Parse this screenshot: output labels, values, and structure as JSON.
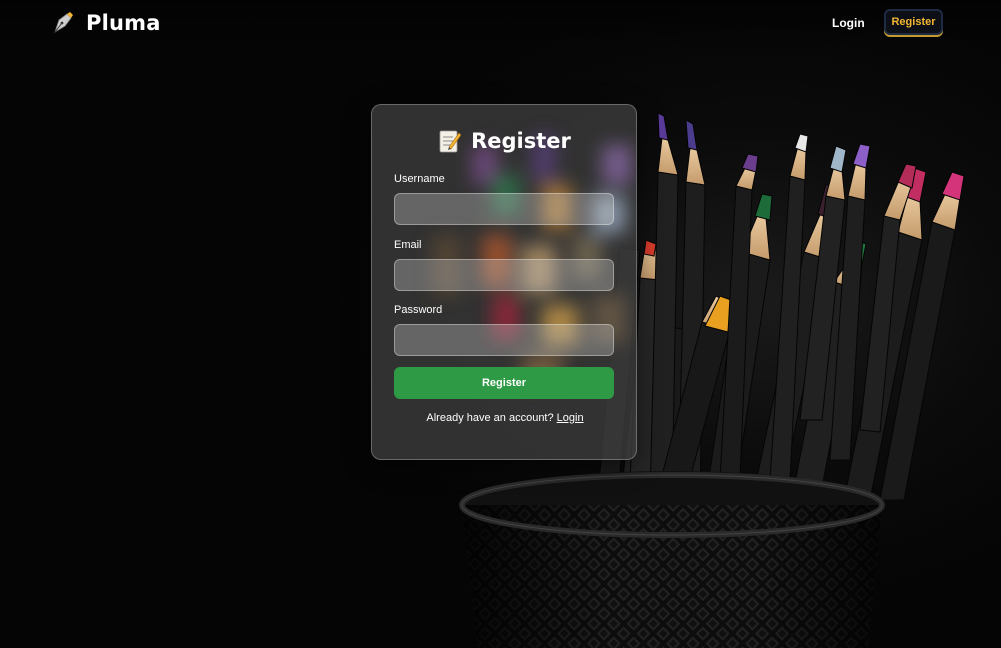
{
  "nav": {
    "brand_name": "Pluma",
    "login_label": "Login",
    "register_label": "Register"
  },
  "form": {
    "title": "Register",
    "username_label": "Username",
    "username_value": "",
    "email_label": "Email",
    "email_value": "",
    "password_label": "Password",
    "password_value": "",
    "submit_label": "Register",
    "switch_prompt": "Already have an account?",
    "switch_link": "Login"
  },
  "icons": {
    "brand": "fountain-pen-icon",
    "title": "memo-icon"
  },
  "colors": {
    "background": "#050505",
    "accent": "#f2b632",
    "submit": "#2e9a45",
    "card": "#3e3e3e"
  }
}
